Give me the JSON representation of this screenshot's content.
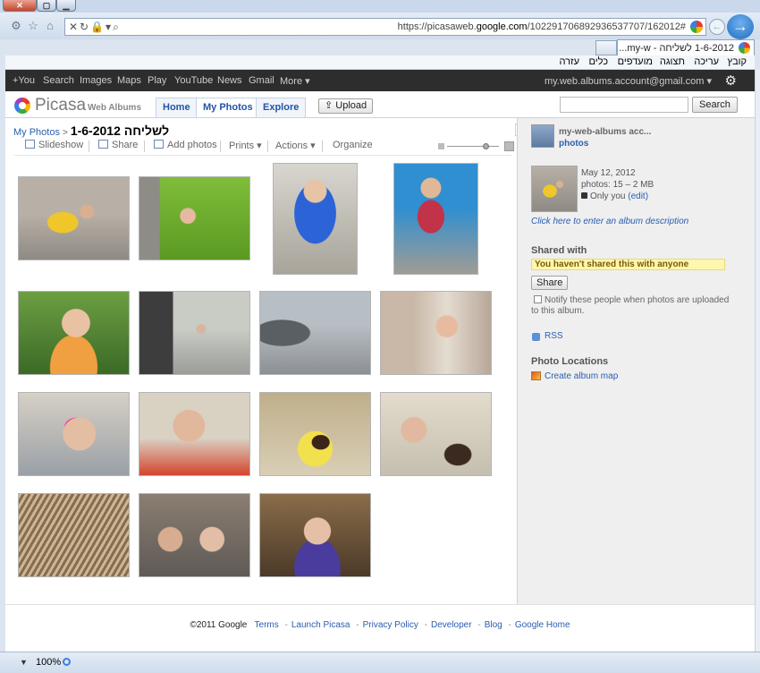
{
  "browser": {
    "url_prefix": "https://picasaweb.",
    "url_domain": "google.com",
    "url_suffix": "/102291706892936537707/162012#",
    "tab_title": "1-6-2012 לשליחה - my-w...",
    "menu": [
      "קובץ",
      "עריכה",
      "תצוגה",
      "מועדפים",
      "כלים",
      "עזרה"
    ],
    "zoom": "100%"
  },
  "google_bar": {
    "links": [
      "+You",
      "Search",
      "Images",
      "Maps",
      "Play",
      "YouTube",
      "News",
      "Gmail",
      "More ▾"
    ],
    "account": "my.web.albums.account@gmail.com ▾"
  },
  "header": {
    "logo": "Picasa",
    "logo_sub": "Web Albums",
    "tabs": [
      "Home",
      "My Photos",
      "Explore"
    ],
    "upload": "Upload",
    "search_button": "Search"
  },
  "album": {
    "breadcrumb_root": "My Photos",
    "breadcrumb_sep": ">",
    "title": "לשליחה 1-6-2012",
    "toolbar": [
      "Slideshow",
      "Share",
      "Add photos",
      "Prints ▾",
      "Actions ▾",
      "Organize"
    ]
  },
  "side": {
    "owner": "my-web-albums acc...",
    "owner_link": "photos",
    "date": "May 12, 2012",
    "photos_info": "photos: 15 – 2 MB",
    "visibility": "Only you",
    "edit": "(edit)",
    "description_link": "Click here to enter an album description",
    "shared_with": "Shared with",
    "not_shared": "You haven't shared this with anyone",
    "share_button": "Share",
    "notify_text": "Notify these people when photos are uploaded to this album.",
    "rss": "RSS",
    "photo_locations": "Photo Locations",
    "create_map": "Create album map"
  },
  "footer": {
    "copyright": "©2011 Google",
    "links": [
      "Terms",
      "Launch Picasa",
      "Privacy Policy",
      "Developer",
      "Blog",
      "Google Home"
    ]
  },
  "colors": {
    "link": "#2a5db0",
    "google_bar": "#2d2d2d",
    "notice_bg": "#fff7ad"
  }
}
